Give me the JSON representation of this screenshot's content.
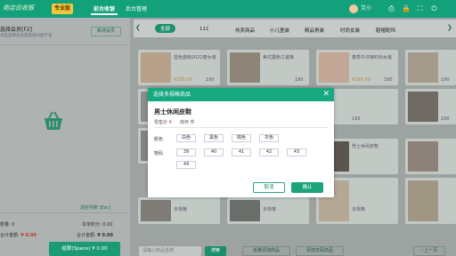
{
  "topbar": {
    "logo": "商店云收银",
    "pro_badge": "专业版",
    "tabs": [
      "前台收银",
      "后台管理"
    ],
    "user": "艾小"
  },
  "left": {
    "member_label": "选择会员[F2]",
    "member_hint": "点击选择会员或直接扫描卡号",
    "add_member_btn": "新增会员",
    "clear_link": "清空列表 [Esc]",
    "rows": [
      {
        "label": "数量:",
        "value": "0",
        "r_label": "本单积分:",
        "r_value": "0.00"
      },
      {
        "label": "合计金额:",
        "value": "¥ 0.00",
        "r_label": "合计金额:",
        "r_value": "¥ 0.00"
      }
    ],
    "checkout_btn": "结算(Space) ¥ 0.00"
  },
  "categories": [
    "全部",
    "111",
    "热卖商品",
    "小儿童装",
    "精品男装",
    "时尚女装",
    "鞋帽配饰"
  ],
  "products": [
    {
      "name": "蓝色旗袍2022春女装",
      "price": "¥259.00",
      "stock": "190"
    },
    {
      "name": "美式露肩工装裤",
      "price": "",
      "stock": "190"
    },
    {
      "name": "春季牛仔裤时尚女装",
      "price": "¥189.00",
      "stock": "190"
    },
    {
      "name": "",
      "price": "",
      "stock": "190"
    },
    {
      "name": "",
      "price": "",
      "stock": "190"
    },
    {
      "name": "",
      "price": "",
      "stock": "190"
    },
    {
      "name": "",
      "price": "",
      "stock": ""
    },
    {
      "name": "",
      "price": "",
      "stock": ""
    },
    {
      "name": "男士休闲皮鞋",
      "price": "",
      "stock": ""
    },
    {
      "name": "多规格",
      "price": "",
      "stock": ""
    },
    {
      "name": "多规格",
      "price": "",
      "stock": ""
    },
    {
      "name": "多规格",
      "price": "",
      "stock": ""
    }
  ],
  "modal": {
    "title": "选择多规格商品",
    "product_name": "男士休闲皮鞋",
    "price_label": "零售价",
    "stock_label": "库存",
    "stock_unit": "件",
    "color_label": "颜色",
    "colors": [
      "白色",
      "黑色",
      "棕色",
      "灰色"
    ],
    "size_label": "鞋码",
    "sizes": [
      "39",
      "40",
      "41",
      "42",
      "43",
      "44"
    ],
    "cancel": "取消",
    "confirm": "确认"
  },
  "bottom": {
    "search_placeholder": "请输入商品名称",
    "search_btn": "搜索",
    "btn2": "批量添加商品",
    "btn3": "添加无码商品",
    "prev": "上一页"
  }
}
